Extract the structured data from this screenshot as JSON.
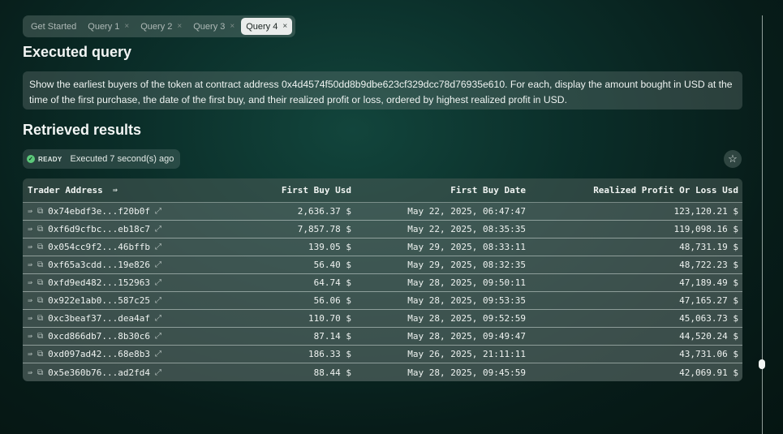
{
  "tabs": [
    {
      "label": "Get Started",
      "closable": false,
      "active": false
    },
    {
      "label": "Query 1",
      "closable": true,
      "active": false
    },
    {
      "label": "Query 2",
      "closable": true,
      "active": false
    },
    {
      "label": "Query 3",
      "closable": true,
      "active": false
    },
    {
      "label": "Query 4",
      "closable": true,
      "active": true
    }
  ],
  "executed_query": {
    "heading": "Executed query",
    "text": "Show the earliest buyers of the token at contract address 0x4d4574f50dd8b9dbe623cf329dcc78d76935e610. For each, display the amount bought in USD at the time of the first purchase, the date of the first buy, and their realized profit or loss, ordered by highest realized profit in USD."
  },
  "results": {
    "heading": "Retrieved results",
    "status_badge": "READY",
    "status_text": "Executed 7 second(s) ago"
  },
  "table": {
    "columns": [
      "Trader Address",
      "First Buy Usd",
      "First Buy Date",
      "Realized Profit Or Loss Usd"
    ],
    "rows": [
      [
        "0x74ebdf3e...f20b0f",
        "2,636.37 $",
        "May 22, 2025, 06:47:47",
        "123,120.21 $"
      ],
      [
        "0xf6d9cfbc...eb18c7",
        "7,857.78 $",
        "May 22, 2025, 08:35:35",
        "119,098.16 $"
      ],
      [
        "0x054cc9f2...46bffb",
        "139.05 $",
        "May 29, 2025, 08:33:11",
        "48,731.19 $"
      ],
      [
        "0xf65a3cdd...19e826",
        "56.40 $",
        "May 29, 2025, 08:32:35",
        "48,722.23 $"
      ],
      [
        "0xfd9ed482...152963",
        "64.74 $",
        "May 28, 2025, 09:50:11",
        "47,189.49 $"
      ],
      [
        "0x922e1ab0...587c25",
        "56.06 $",
        "May 28, 2025, 09:53:35",
        "47,165.27 $"
      ],
      [
        "0xc3beaf37...dea4af",
        "110.70 $",
        "May 28, 2025, 09:52:59",
        "45,063.73 $"
      ],
      [
        "0xcd866db7...8b30c6",
        "87.14 $",
        "May 28, 2025, 09:49:47",
        "44,520.24 $"
      ],
      [
        "0xd097ad42...68e8b3",
        "186.33 $",
        "May 26, 2025, 21:11:11",
        "43,731.06 $"
      ],
      [
        "0x5e360b76...ad2fd4",
        "88.44 $",
        "May 28, 2025, 09:45:59",
        "42,069.91 $"
      ]
    ]
  },
  "icons": {
    "tab_close": "×",
    "sort": "⇛",
    "filter": "⇛",
    "copy": "⧉",
    "external_link": "⤢",
    "star": "☆",
    "check": "✓"
  }
}
